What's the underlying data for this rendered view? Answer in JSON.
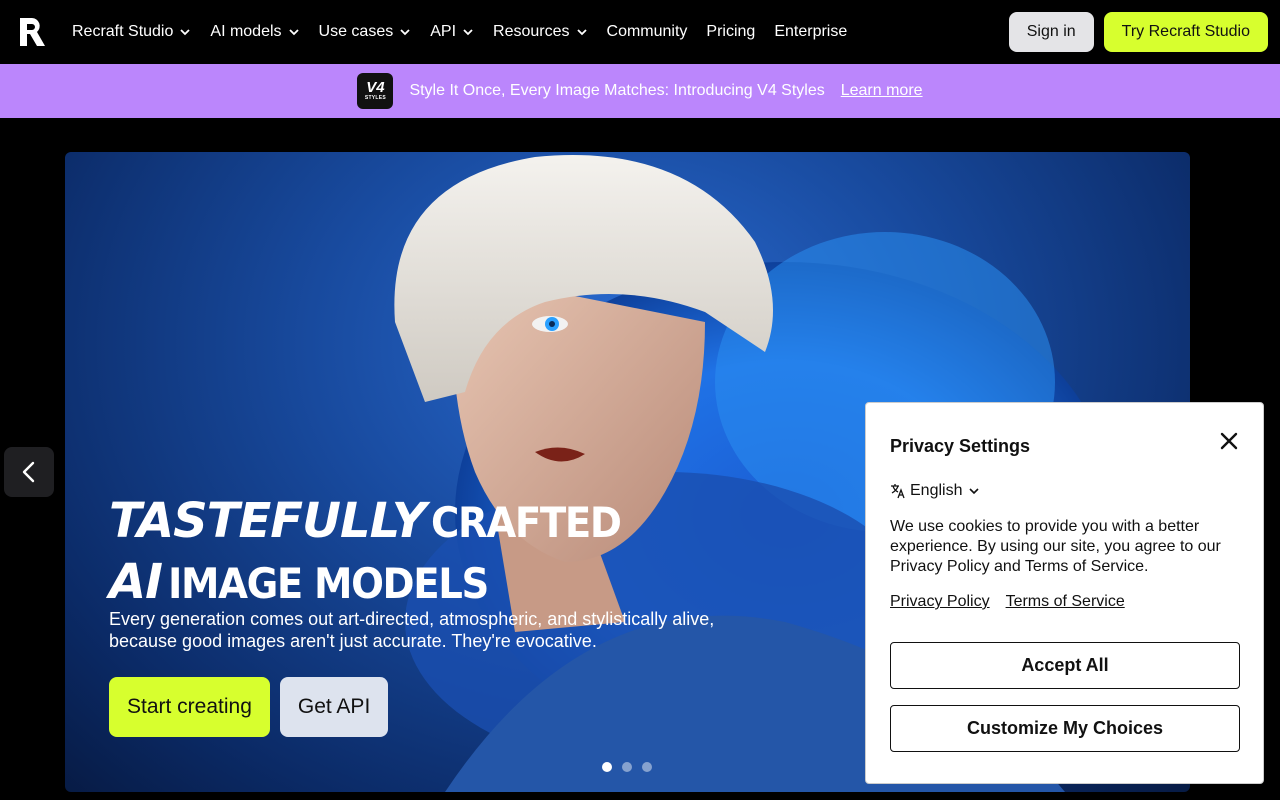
{
  "nav": {
    "logo_icon": "recraft-logo-icon",
    "menu": [
      {
        "label": "Recraft Studio",
        "has_dropdown": true
      },
      {
        "label": "AI models",
        "has_dropdown": true
      },
      {
        "label": "Use cases",
        "has_dropdown": true
      },
      {
        "label": "API",
        "has_dropdown": true
      },
      {
        "label": "Resources",
        "has_dropdown": true
      },
      {
        "label": "Community",
        "has_dropdown": false
      },
      {
        "label": "Pricing",
        "has_dropdown": false
      },
      {
        "label": "Enterprise",
        "has_dropdown": false
      }
    ],
    "sign_in": "Sign in",
    "try_studio": "Try Recraft Studio"
  },
  "banner": {
    "badge_main": "V4",
    "badge_sub": "STYLES",
    "text": "Style It Once, Every Image Matches: Introducing V4 Styles",
    "link": "Learn more",
    "bg_color": "#bb86fc"
  },
  "hero": {
    "title_italic_1": "TASTEFULLY",
    "title_cond_1": "CRAFTED",
    "title_italic_2": "AI",
    "title_cond_2": "IMAGE MODELS",
    "subtitle": "Every generation comes out art-directed, atmospheric, and stylistically alive, because good images aren't just accurate. They're evocative.",
    "start_button": "Start creating",
    "api_button": "Get API",
    "slides_total": 3,
    "active_slide": 1,
    "accent_color": "#d7ff2e"
  },
  "privacy": {
    "title": "Privacy Settings",
    "language": "English",
    "body": "We use cookies to provide you with a better experience. By using our site, you agree to our Privacy Policy and Terms of Service.",
    "links": [
      "Privacy Policy",
      "Terms of Service"
    ],
    "accept": "Accept All",
    "customize": "Customize My Choices"
  }
}
